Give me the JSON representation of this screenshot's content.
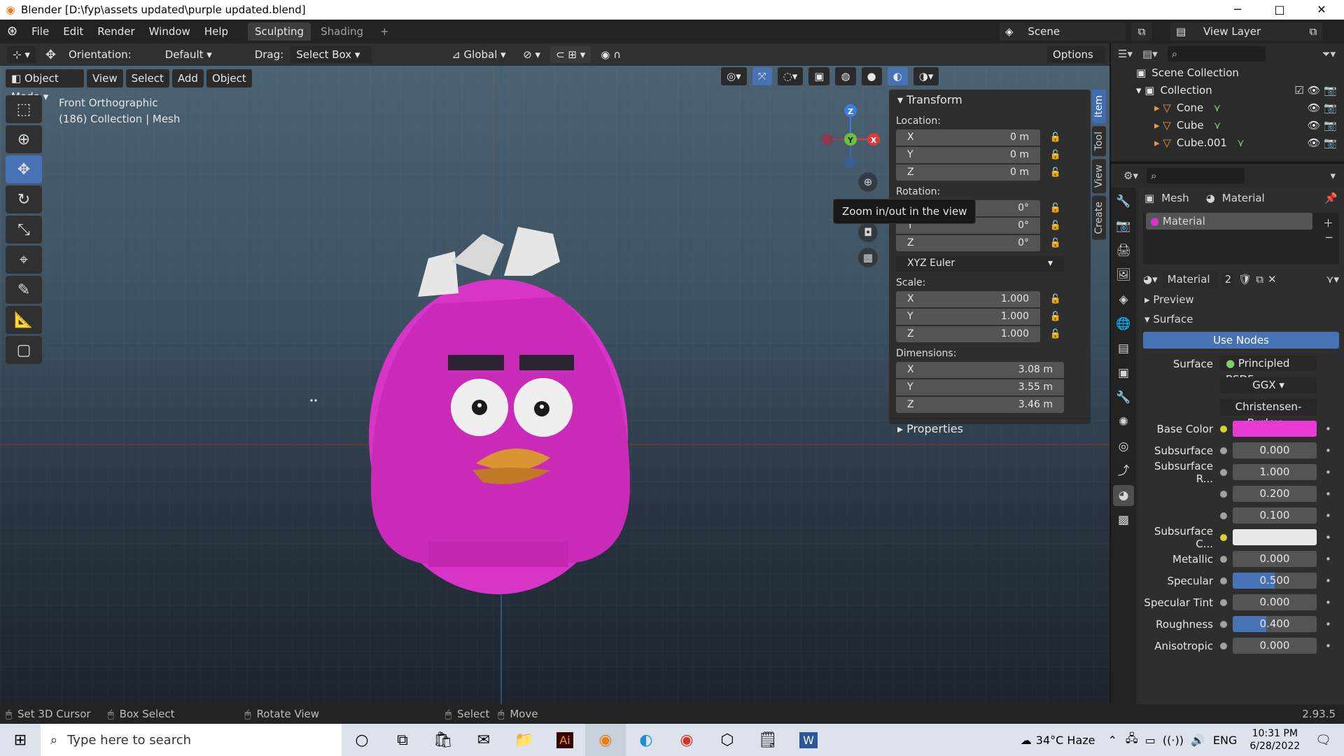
{
  "window": {
    "title": "Blender [D:\\fyp\\assets updated\\purple updated.blend]",
    "min": "─",
    "max": "□",
    "close": "✕"
  },
  "menu": {
    "items": [
      "File",
      "Edit",
      "Render",
      "Window",
      "Help"
    ],
    "tabs": [
      "Sculpting",
      "Shading"
    ],
    "add": "+",
    "scene": "Scene",
    "view_layer": "View Layer"
  },
  "header": {
    "orientation_label": "Orientation:",
    "orientation_value": "Default",
    "drag_label": "Drag:",
    "drag_value": "Select Box",
    "transform_space": "Global",
    "options": "Options"
  },
  "viewport": {
    "mode": "Object Mode",
    "menus": [
      "View",
      "Select",
      "Add",
      "Object"
    ],
    "view_name": "Front Orthographic",
    "collection_info": "(186) Collection | Mesh",
    "tooltip": "Zoom in/out in the view",
    "gizmo": {
      "z": "Z",
      "y": "Y",
      "x": "X"
    }
  },
  "npanel": {
    "title": "Transform",
    "location_label": "Location:",
    "location": [
      {
        "axis": "X",
        "value": "0 m"
      },
      {
        "axis": "Y",
        "value": "0 m"
      },
      {
        "axis": "Z",
        "value": "0 m"
      }
    ],
    "rotation_label": "Rotation:",
    "rotation": [
      {
        "axis": "X",
        "value": "0°"
      },
      {
        "axis": "Y",
        "value": "0°"
      },
      {
        "axis": "Z",
        "value": "0°"
      }
    ],
    "rotation_mode": "XYZ Euler",
    "scale_label": "Scale:",
    "scale": [
      {
        "axis": "X",
        "value": "1.000"
      },
      {
        "axis": "Y",
        "value": "1.000"
      },
      {
        "axis": "Z",
        "value": "1.000"
      }
    ],
    "dimensions_label": "Dimensions:",
    "dimensions": [
      {
        "axis": "X",
        "value": "3.08 m"
      },
      {
        "axis": "Y",
        "value": "3.55 m"
      },
      {
        "axis": "Z",
        "value": "3.46 m"
      }
    ],
    "properties": "Properties",
    "tabs": [
      "Item",
      "Tool",
      "View",
      "Create"
    ]
  },
  "outliner": {
    "root": "Scene Collection",
    "collection": "Collection",
    "items": [
      "Cone",
      "Cube",
      "Cube.001"
    ]
  },
  "properties": {
    "breadcrumb_mesh": "Mesh",
    "breadcrumb_material": "Material",
    "slot": "Material",
    "material_name": "Material",
    "user_count": "2",
    "preview": "Preview",
    "surface_section": "Surface",
    "use_nodes": "Use Nodes",
    "surface_label": "Surface",
    "surface_value": "Principled BSDF",
    "distribution": "GGX",
    "subsurface_method": "Christensen-Burley",
    "rows": [
      {
        "k": "Base Color",
        "v": "",
        "color": "#e83bd6"
      },
      {
        "k": "Subsurface",
        "v": "0.000"
      },
      {
        "k": "Subsurface R...",
        "v": "1.000"
      },
      {
        "k": "",
        "v": "0.200"
      },
      {
        "k": "",
        "v": "0.100"
      },
      {
        "k": "Subsurface C...",
        "v": "",
        "color": "#e8e8e8"
      },
      {
        "k": "Metallic",
        "v": "0.000"
      },
      {
        "k": "Specular",
        "v": "0.500",
        "fill": 0.5
      },
      {
        "k": "Specular Tint",
        "v": "0.000"
      },
      {
        "k": "Roughness",
        "v": "0.400",
        "fill": 0.4
      },
      {
        "k": "Anisotropic",
        "v": "0.000"
      }
    ]
  },
  "status": {
    "items": [
      "Set 3D Cursor",
      "Box Select",
      "Rotate View",
      "Select",
      "Move"
    ],
    "version": "2.93.5"
  },
  "taskbar": {
    "search_placeholder": "Type here to search",
    "weather": "34°C  Haze",
    "lang": "ENG",
    "time": "10:31 PM",
    "date": "6/28/2022"
  }
}
